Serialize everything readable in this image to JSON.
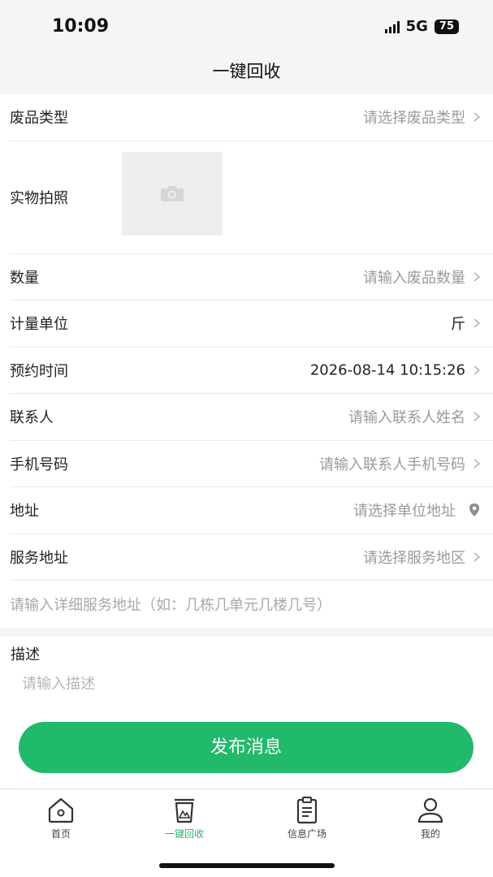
{
  "status_bar": {
    "time": "10:09",
    "network": "5G",
    "battery": "75"
  },
  "header": {
    "title": "一键回收"
  },
  "form": {
    "waste_type": {
      "label": "废品类型",
      "placeholder": "请选择废品类型"
    },
    "photo": {
      "label": "实物拍照",
      "icon": "camera-icon"
    },
    "quantity": {
      "label": "数量",
      "placeholder": "请输入废品数量"
    },
    "unit": {
      "label": "计量单位",
      "value": "斤"
    },
    "appointment": {
      "label": "预约时间",
      "value": "2026-08-14 10:15:26"
    },
    "contact": {
      "label": "联系人",
      "placeholder": "请输入联系人姓名"
    },
    "phone": {
      "label": "手机号码",
      "placeholder": "请输入联系人手机号码"
    },
    "address": {
      "label": "地址",
      "placeholder": "请选择单位地址",
      "icon": "location-pin-icon"
    },
    "service_area": {
      "label": "服务地址",
      "placeholder": "请选择服务地区"
    },
    "detail_address": {
      "placeholder": "请输入详细服务地址（如：几栋几单元几楼几号）"
    },
    "description": {
      "label": "描述",
      "placeholder": "请输入描述"
    }
  },
  "submit": {
    "label": "发布消息"
  },
  "tabbar": {
    "items": [
      {
        "label": "首页",
        "icon": "home-icon",
        "active": false
      },
      {
        "label": "一键回收",
        "icon": "recycle-bin-icon",
        "active": true
      },
      {
        "label": "信息广场",
        "icon": "clipboard-icon",
        "active": false
      },
      {
        "label": "我的",
        "icon": "user-icon",
        "active": false
      }
    ]
  },
  "colors": {
    "accent": "#21b96a",
    "placeholder": "#9a9a9a",
    "header_bg": "#f5f5f5"
  }
}
